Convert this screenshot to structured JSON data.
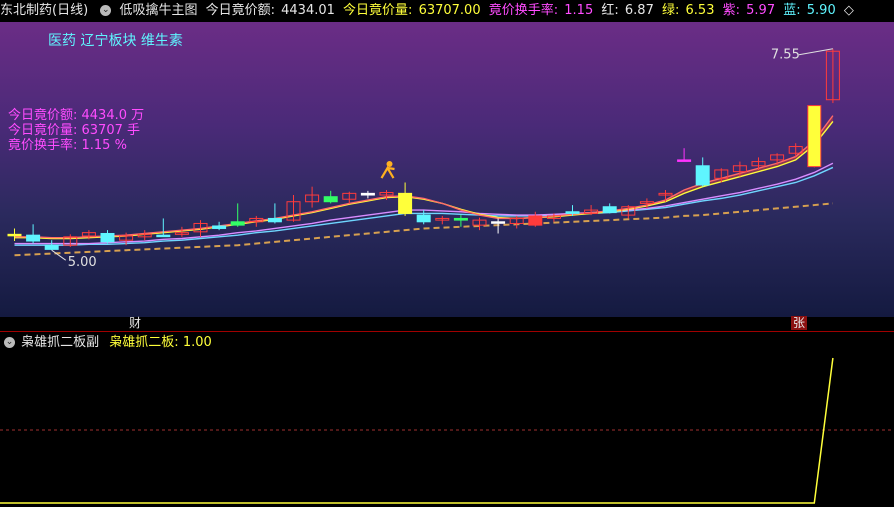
{
  "header": {
    "stock_name": "东北制药(日线)",
    "indicator": "低吸擒牛主图",
    "auction_amount_label": "今日竟价额:",
    "auction_amount_value": "4434.01",
    "auction_volume_label": "今日竟价量:",
    "auction_volume_value": "63707.00",
    "turnover_label": "竟价换手率:",
    "turnover_value": "1.15",
    "red_label": "红:",
    "red_value": "6.87",
    "green_label": "绿:",
    "green_value": "6.53",
    "purple_label": "紫:",
    "purple_value": "5.97",
    "blue_label": "蓝:",
    "blue_value": "5.90",
    "expand_glyph": "◇"
  },
  "tags": "医药 辽宁板块 维生素",
  "info": {
    "line1": "今日竟价额: 4434.0 万",
    "line2": "今日竟价量: 63707 手",
    "line3": "竟价换手率: 1.15 %"
  },
  "markers": {
    "high_label": "7.55",
    "low_label": "5.00",
    "cai": "财",
    "zhang": "张"
  },
  "sub": {
    "title": "枭雄抓二板副",
    "value_label": "枭雄抓二板:",
    "value": "1.00"
  },
  "colors": {
    "up": "#ff3b3b",
    "down": "#5ff5ff",
    "ma_red": "#ff6a6a",
    "ma_yellow": "#ffff3a",
    "ma_purple": "#d98cff",
    "ma_blue": "#6fd6ff",
    "ma_orange": "#d7a050"
  },
  "chart_data": {
    "type": "candlestick",
    "ylim": [
      4.7,
      7.75
    ],
    "candles": [
      {
        "o": 5.33,
        "h": 5.4,
        "l": 5.25,
        "c": 5.33,
        "col": "yellow"
      },
      {
        "o": 5.32,
        "h": 5.45,
        "l": 5.22,
        "c": 5.25,
        "col": "cyan"
      },
      {
        "o": 5.2,
        "h": 5.26,
        "l": 5.14,
        "c": 5.15,
        "col": "cyan"
      },
      {
        "o": 5.2,
        "h": 5.33,
        "l": 5.18,
        "c": 5.3,
        "col": "red"
      },
      {
        "o": 5.31,
        "h": 5.38,
        "l": 5.27,
        "c": 5.35,
        "col": "red"
      },
      {
        "o": 5.34,
        "h": 5.38,
        "l": 5.22,
        "c": 5.24,
        "col": "cyan"
      },
      {
        "o": 5.26,
        "h": 5.35,
        "l": 5.2,
        "c": 5.31,
        "col": "red"
      },
      {
        "o": 5.3,
        "h": 5.38,
        "l": 5.26,
        "c": 5.33,
        "col": "red"
      },
      {
        "o": 5.32,
        "h": 5.52,
        "l": 5.3,
        "c": 5.32,
        "col": "cyan"
      },
      {
        "o": 5.33,
        "h": 5.42,
        "l": 5.3,
        "c": 5.35,
        "col": "red"
      },
      {
        "o": 5.36,
        "h": 5.5,
        "l": 5.3,
        "c": 5.46,
        "col": "red"
      },
      {
        "o": 5.43,
        "h": 5.48,
        "l": 5.38,
        "c": 5.4,
        "col": "cyan"
      },
      {
        "o": 5.44,
        "h": 5.7,
        "l": 5.42,
        "c": 5.48,
        "col": "green"
      },
      {
        "o": 5.48,
        "h": 5.55,
        "l": 5.42,
        "c": 5.52,
        "col": "red"
      },
      {
        "o": 5.52,
        "h": 5.7,
        "l": 5.46,
        "c": 5.48,
        "col": "cyan"
      },
      {
        "o": 5.5,
        "h": 5.8,
        "l": 5.48,
        "c": 5.72,
        "col": "red"
      },
      {
        "o": 5.72,
        "h": 5.9,
        "l": 5.65,
        "c": 5.8,
        "col": "red"
      },
      {
        "o": 5.78,
        "h": 5.85,
        "l": 5.7,
        "c": 5.72,
        "col": "green"
      },
      {
        "o": 5.75,
        "h": 5.84,
        "l": 5.7,
        "c": 5.82,
        "col": "red"
      },
      {
        "o": 5.82,
        "h": 5.85,
        "l": 5.76,
        "c": 5.8,
        "col": "white"
      },
      {
        "o": 5.8,
        "h": 5.86,
        "l": 5.74,
        "c": 5.83,
        "col": "red"
      },
      {
        "o": 5.82,
        "h": 5.95,
        "l": 5.55,
        "c": 5.58,
        "col": "yellow"
      },
      {
        "o": 5.56,
        "h": 5.62,
        "l": 5.45,
        "c": 5.48,
        "col": "cyan"
      },
      {
        "o": 5.5,
        "h": 5.55,
        "l": 5.45,
        "c": 5.52,
        "col": "red"
      },
      {
        "o": 5.52,
        "h": 5.56,
        "l": 5.42,
        "c": 5.5,
        "col": "green"
      },
      {
        "o": 5.5,
        "h": 5.53,
        "l": 5.38,
        "c": 5.44,
        "col": "red"
      },
      {
        "o": 5.48,
        "h": 5.52,
        "l": 5.34,
        "c": 5.47,
        "col": "white"
      },
      {
        "o": 5.46,
        "h": 5.55,
        "l": 5.4,
        "c": 5.52,
        "col": "red"
      },
      {
        "o": 5.44,
        "h": 5.6,
        "l": 5.42,
        "c": 5.55,
        "col": "redfill"
      },
      {
        "o": 5.52,
        "h": 5.58,
        "l": 5.48,
        "c": 5.55,
        "col": "red"
      },
      {
        "o": 5.6,
        "h": 5.68,
        "l": 5.55,
        "c": 5.58,
        "col": "cyan"
      },
      {
        "o": 5.62,
        "h": 5.68,
        "l": 5.56,
        "c": 5.58,
        "col": "red"
      },
      {
        "o": 5.66,
        "h": 5.7,
        "l": 5.58,
        "c": 5.59,
        "col": "cyan"
      },
      {
        "o": 5.56,
        "h": 5.68,
        "l": 5.52,
        "c": 5.66,
        "col": "red"
      },
      {
        "o": 5.7,
        "h": 5.76,
        "l": 5.64,
        "c": 5.72,
        "col": "red"
      },
      {
        "o": 5.8,
        "h": 5.86,
        "l": 5.72,
        "c": 5.82,
        "col": "red"
      },
      {
        "o": 6.22,
        "h": 6.36,
        "l": 6.2,
        "c": 6.22,
        "col": "magenta"
      },
      {
        "o": 6.15,
        "h": 6.25,
        "l": 5.9,
        "c": 5.92,
        "col": "cyan"
      },
      {
        "o": 6.0,
        "h": 6.12,
        "l": 5.95,
        "c": 6.1,
        "col": "red"
      },
      {
        "o": 6.08,
        "h": 6.2,
        "l": 6.02,
        "c": 6.15,
        "col": "red"
      },
      {
        "o": 6.15,
        "h": 6.25,
        "l": 6.1,
        "c": 6.2,
        "col": "red"
      },
      {
        "o": 6.22,
        "h": 6.3,
        "l": 6.16,
        "c": 6.28,
        "col": "red"
      },
      {
        "o": 6.3,
        "h": 6.42,
        "l": 6.26,
        "c": 6.38,
        "col": "red"
      },
      {
        "o": 6.14,
        "h": 6.87,
        "l": 6.13,
        "c": 6.87,
        "col": "yellowred"
      },
      {
        "o": 6.94,
        "h": 7.55,
        "l": 6.9,
        "c": 7.52,
        "col": "red"
      }
    ],
    "ma_red": [
      5.3,
      5.3,
      5.29,
      5.29,
      5.3,
      5.31,
      5.32,
      5.34,
      5.36,
      5.38,
      5.4,
      5.43,
      5.46,
      5.49,
      5.52,
      5.56,
      5.6,
      5.65,
      5.7,
      5.74,
      5.78,
      5.79,
      5.76,
      5.7,
      5.62,
      5.56,
      5.52,
      5.52,
      5.53,
      5.55,
      5.57,
      5.59,
      5.61,
      5.64,
      5.68,
      5.74,
      5.86,
      5.94,
      6.0,
      6.06,
      6.12,
      6.18,
      6.26,
      6.45,
      6.75
    ],
    "ma_yellow": [
      5.29,
      5.29,
      5.28,
      5.28,
      5.29,
      5.3,
      5.31,
      5.33,
      5.35,
      5.37,
      5.39,
      5.42,
      5.45,
      5.48,
      5.51,
      5.55,
      5.59,
      5.64,
      5.69,
      5.73,
      5.77,
      5.78,
      5.75,
      5.7,
      5.63,
      5.57,
      5.53,
      5.52,
      5.53,
      5.54,
      5.56,
      5.58,
      5.6,
      5.63,
      5.67,
      5.72,
      5.82,
      5.9,
      5.96,
      6.02,
      6.08,
      6.14,
      6.22,
      6.4,
      6.68
    ],
    "ma_purple": [
      5.22,
      5.22,
      5.22,
      5.22,
      5.22,
      5.23,
      5.24,
      5.25,
      5.27,
      5.28,
      5.3,
      5.32,
      5.35,
      5.37,
      5.4,
      5.43,
      5.46,
      5.5,
      5.53,
      5.56,
      5.59,
      5.62,
      5.62,
      5.61,
      5.6,
      5.58,
      5.57,
      5.56,
      5.56,
      5.57,
      5.58,
      5.59,
      5.61,
      5.62,
      5.64,
      5.67,
      5.71,
      5.75,
      5.79,
      5.83,
      5.88,
      5.93,
      5.99,
      6.07,
      6.18
    ],
    "ma_blue": [
      5.2,
      5.2,
      5.2,
      5.2,
      5.21,
      5.21,
      5.22,
      5.23,
      5.25,
      5.26,
      5.28,
      5.3,
      5.32,
      5.35,
      5.37,
      5.4,
      5.43,
      5.46,
      5.49,
      5.52,
      5.55,
      5.58,
      5.58,
      5.58,
      5.57,
      5.56,
      5.55,
      5.55,
      5.55,
      5.56,
      5.57,
      5.58,
      5.59,
      5.61,
      5.63,
      5.65,
      5.69,
      5.73,
      5.76,
      5.8,
      5.85,
      5.9,
      5.95,
      6.03,
      6.13
    ],
    "ma_orange": [
      5.08,
      5.09,
      5.1,
      5.11,
      5.12,
      5.13,
      5.14,
      5.15,
      5.16,
      5.17,
      5.18,
      5.19,
      5.2,
      5.22,
      5.24,
      5.26,
      5.28,
      5.3,
      5.32,
      5.34,
      5.36,
      5.38,
      5.4,
      5.41,
      5.42,
      5.43,
      5.44,
      5.45,
      5.46,
      5.47,
      5.48,
      5.49,
      5.5,
      5.51,
      5.52,
      5.53,
      5.55,
      5.56,
      5.58,
      5.6,
      5.62,
      5.64,
      5.66,
      5.68,
      5.7
    ],
    "sub_values": [
      0,
      0,
      0,
      0,
      0,
      0,
      0,
      0,
      0,
      0,
      0,
      0,
      0,
      0,
      0,
      0,
      0,
      0,
      0,
      0,
      0,
      0,
      0,
      0,
      0,
      0,
      0,
      0,
      0,
      0,
      0,
      0,
      0,
      0,
      0,
      0,
      0,
      0,
      0,
      0,
      0,
      0,
      0,
      0,
      1.0
    ],
    "sub_ylim": [
      0,
      1.0
    ]
  }
}
